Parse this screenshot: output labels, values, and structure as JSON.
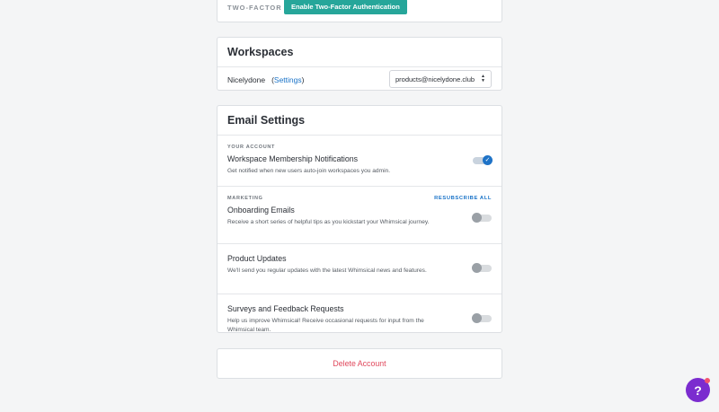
{
  "security": {
    "two_factor_label": "TWO-FACTOR",
    "enable_button": "Enable Two-Factor Authentication"
  },
  "workspaces": {
    "title": "Workspaces",
    "name": "Nicelydone",
    "settings_open": "(",
    "settings_link": "Settings",
    "settings_close": ")",
    "selected_email": "products@nicelydone.club"
  },
  "email_settings": {
    "title": "Email Settings",
    "your_account_label": "YOUR ACCOUNT",
    "membership": {
      "title": "Workspace Membership Notifications",
      "desc": "Get notified when new users auto-join workspaces you admin.",
      "enabled": true
    },
    "marketing_label": "MARKETING",
    "unsubscribe_all": "RESUBSCRIBE ALL",
    "onboarding": {
      "title": "Onboarding Emails",
      "desc": "Receive a short series of helpful tips as you kickstart your Whimsical journey.",
      "enabled": false
    },
    "product_updates": {
      "title": "Product Updates",
      "desc": "We'll send you regular updates with the latest Whimsical news and features.",
      "enabled": false
    },
    "surveys": {
      "title": "Surveys and Feedback Requests",
      "desc": "Help us improve Whimsical! Receive occasional requests for input from the Whimsical team.",
      "enabled": false
    }
  },
  "delete_account": "Delete Account",
  "help_glyph": "?",
  "colors": {
    "accent": "#26a69a",
    "link": "#1a73c8",
    "danger": "#e0485c",
    "help_bubble": "#7b2ccf"
  }
}
